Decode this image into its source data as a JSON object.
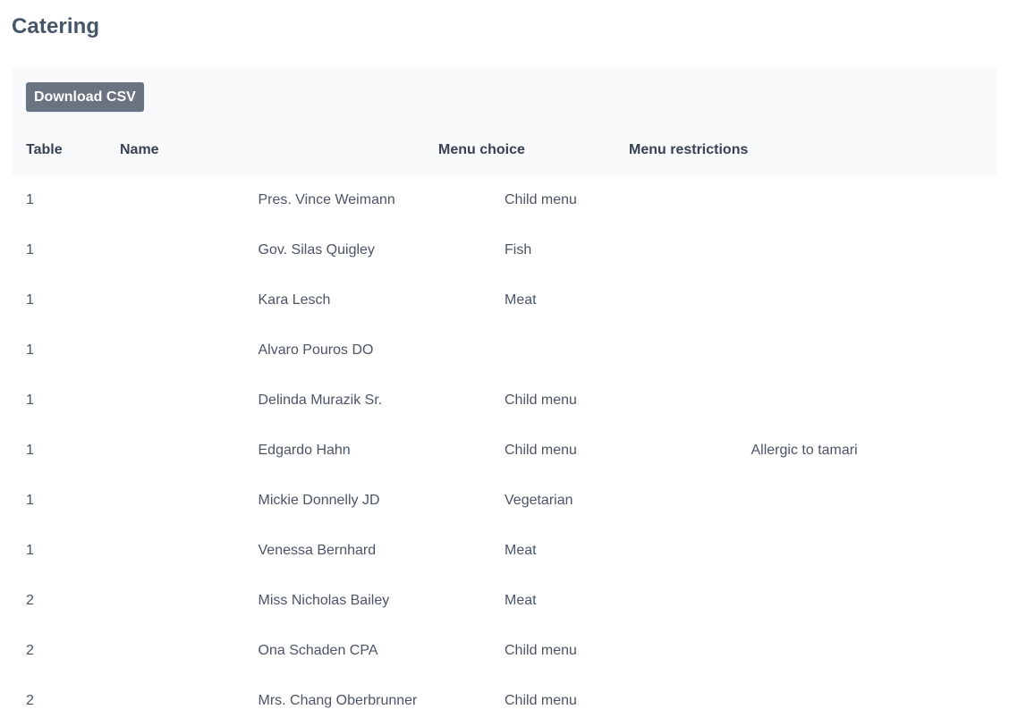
{
  "page": {
    "title": "Catering"
  },
  "toolbar": {
    "download_label": "Download CSV"
  },
  "table": {
    "headers": {
      "table": "Table",
      "name": "Name",
      "menu_choice": "Menu choice",
      "menu_restrictions": "Menu restrictions"
    },
    "rows": [
      {
        "table": "1",
        "name": "Pres. Vince Weimann",
        "menu_choice": "Child menu",
        "menu_restrictions": ""
      },
      {
        "table": "1",
        "name": "Gov. Silas Quigley",
        "menu_choice": "Fish",
        "menu_restrictions": ""
      },
      {
        "table": "1",
        "name": "Kara Lesch",
        "menu_choice": "Meat",
        "menu_restrictions": ""
      },
      {
        "table": "1",
        "name": "Alvaro Pouros DO",
        "menu_choice": "",
        "menu_restrictions": ""
      },
      {
        "table": "1",
        "name": "Delinda Murazik Sr.",
        "menu_choice": "Child menu",
        "menu_restrictions": ""
      },
      {
        "table": "1",
        "name": "Edgardo Hahn",
        "menu_choice": "Child menu",
        "menu_restrictions": "Allergic to tamari"
      },
      {
        "table": "1",
        "name": "Mickie Donnelly JD",
        "menu_choice": "Vegetarian",
        "menu_restrictions": ""
      },
      {
        "table": "1",
        "name": "Venessa Bernhard",
        "menu_choice": "Meat",
        "menu_restrictions": ""
      },
      {
        "table": "2",
        "name": "Miss Nicholas Bailey",
        "menu_choice": "Meat",
        "menu_restrictions": ""
      },
      {
        "table": "2",
        "name": "Ona Schaden CPA",
        "menu_choice": "Child menu",
        "menu_restrictions": ""
      },
      {
        "table": "2",
        "name": "Mrs. Chang Oberbrunner",
        "menu_choice": "Child menu",
        "menu_restrictions": ""
      }
    ]
  },
  "colors": {
    "header_background": "#f8fafc",
    "button_background": "#6b7280",
    "title_text": "#475569",
    "body_text": "#4b5563"
  }
}
